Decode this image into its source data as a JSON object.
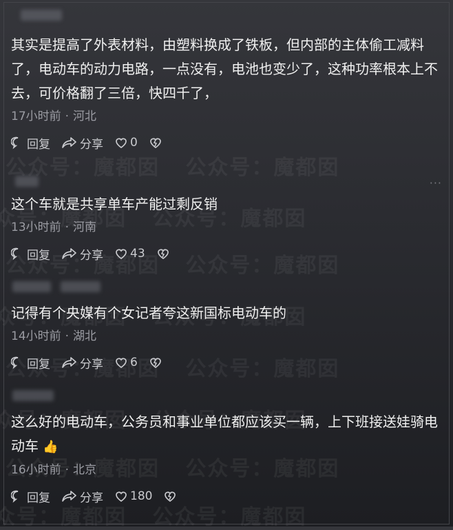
{
  "watermark": "公众号：魔都囡",
  "comments": [
    {
      "text": "其实是提高了外表材料，由塑料换成了铁板，但内部的主体偷工减料了，电动车的动力电路，一点没有，电池也变少了，这种功率根本上不去，可价格翻了三倍，快四千了，",
      "time": "17小时前",
      "location": "河北",
      "reply": "回复",
      "share": "分享",
      "likes": "0"
    },
    {
      "text": "这个车就是共享单车产能过剩反销",
      "time": "13小时前",
      "location": "河南",
      "reply": "回复",
      "share": "分享",
      "likes": "43"
    },
    {
      "text": "记得有个央媒有个女记者夸这新国标电动车的",
      "time": "14小时前",
      "location": "湖北",
      "reply": "回复",
      "share": "分享",
      "likes": "6"
    },
    {
      "text": "这么好的电动车，公务员和事业单位都应该买一辆，上下班接送娃骑电动车",
      "emoji": "👍",
      "time": "16小时前",
      "location": "北京",
      "reply": "回复",
      "share": "分享",
      "likes": "180"
    }
  ],
  "meta_separator": "·",
  "more_menu": "···"
}
